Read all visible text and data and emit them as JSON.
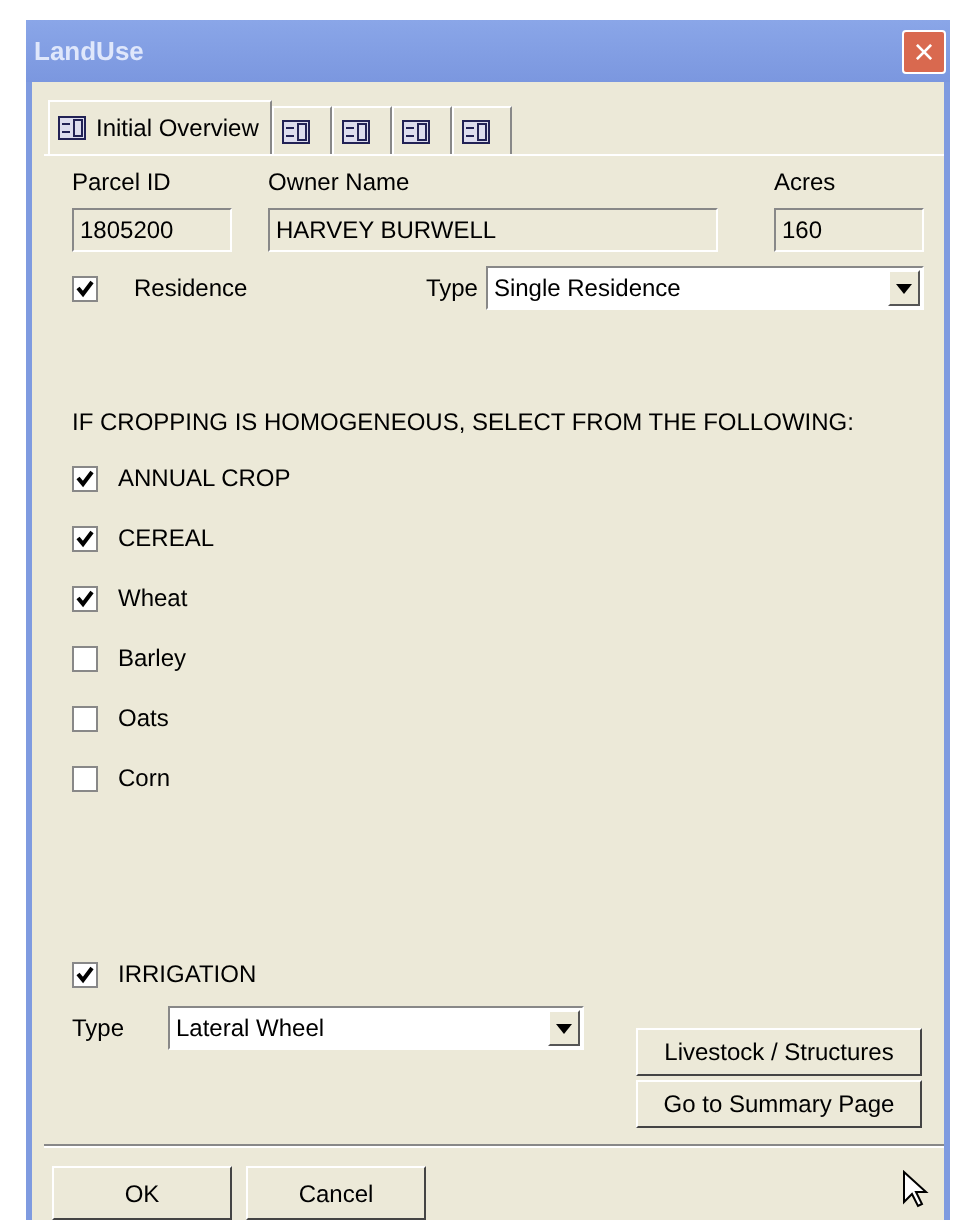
{
  "window": {
    "title": "LandUse",
    "close": "×"
  },
  "tabs": [
    {
      "label": "Initial Overview",
      "selected": true
    },
    {
      "selected": false
    },
    {
      "selected": false
    },
    {
      "selected": false
    },
    {
      "selected": false
    }
  ],
  "parcel": {
    "label": "Parcel ID",
    "value": "1805200"
  },
  "owner": {
    "label": "Owner Name",
    "value": "HARVEY BURWELL"
  },
  "acres": {
    "label": "Acres",
    "value": "160"
  },
  "residence": {
    "label": "Residence",
    "checked": true,
    "type_label": "Type",
    "type_value": "Single Residence"
  },
  "crop_heading": "IF CROPPING IS HOMOGENEOUS, SELECT FROM THE FOLLOWING:",
  "crops": [
    {
      "label": "ANNUAL CROP",
      "checked": true
    },
    {
      "label": "CEREAL",
      "checked": true
    },
    {
      "label": "Wheat",
      "checked": true
    },
    {
      "label": "Barley",
      "checked": false
    },
    {
      "label": "Oats",
      "checked": false
    },
    {
      "label": "Corn",
      "checked": false
    }
  ],
  "irrigation": {
    "label": "IRRIGATION",
    "checked": true,
    "type_label": "Type",
    "type_value": "Lateral Wheel"
  },
  "side_buttons": [
    "Livestock / Structures",
    "Go to Summary Page"
  ],
  "buttons": [
    "OK",
    "Cancel"
  ]
}
